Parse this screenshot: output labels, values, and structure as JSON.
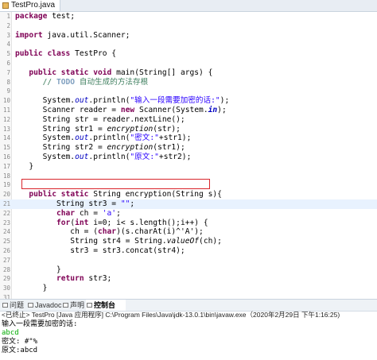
{
  "editor_tab": {
    "label": "TestPro.java"
  },
  "code_lines": [
    {
      "n": "1",
      "html": "<span class=\"kw\">package</span> test;"
    },
    {
      "n": "2",
      "html": ""
    },
    {
      "n": "3",
      "html": "<span class=\"kw\">import</span> java.util.Scanner;"
    },
    {
      "n": "4",
      "html": ""
    },
    {
      "n": "5",
      "html": "<span class=\"kw\">public</span> <span class=\"kw\">class</span> TestPro {"
    },
    {
      "n": "6",
      "html": ""
    },
    {
      "n": "7",
      "html": "   <span class=\"kw\">public</span> <span class=\"kw\">static</span> <span class=\"kw\">void</span> main(String[] args) {"
    },
    {
      "n": "8",
      "html": "      <span class=\"cmt\">// </span><span class=\"todo\">TODO</span><span class=\"cmt\"> 自动生成的方法存根</span>"
    },
    {
      "n": "9",
      "html": ""
    },
    {
      "n": "10",
      "html": "      System.<span class=\"fld\">out</span>.println(<span class=\"str\">\"输入一段需要加密的话:\"</span>);"
    },
    {
      "n": "11",
      "html": "      Scanner reader = <span class=\"kw\">new</span> Scanner(System.<span class=\"fldb\">in</span>);"
    },
    {
      "n": "12",
      "html": "      String str = reader.nextLine();"
    },
    {
      "n": "13",
      "html": "      String str1 = <span class=\"ital\">encryption</span>(str);"
    },
    {
      "n": "14",
      "html": "      System.<span class=\"fld\">out</span>.println(<span class=\"str\">\"密文:\"</span>+str1);"
    },
    {
      "n": "15",
      "html": "      String str2 = <span class=\"ital\">encryption</span>(str1);"
    },
    {
      "n": "16",
      "html": "      System.<span class=\"fld\">out</span>.println(<span class=\"str\">\"原文:\"</span>+str2);"
    },
    {
      "n": "17",
      "html": "   }"
    },
    {
      "n": "18",
      "html": ""
    },
    {
      "n": "19",
      "html": ""
    },
    {
      "n": "20",
      "html": "   <span class=\"kw\">public</span> <span class=\"kw\">static</span> String encryption(String s){"
    },
    {
      "n": "21",
      "html": "         String str3 = <span class=\"str\">\"\"</span>;"
    },
    {
      "n": "22",
      "html": "         <span class=\"kw\">char</span> ch = <span class=\"str\">'a'</span>;"
    },
    {
      "n": "23",
      "html": "         <span class=\"kw\">for</span>(<span class=\"kw\">int</span> i=0; i< s.length();i++) {"
    },
    {
      "n": "24",
      "html": "            ch = (<span class=\"kw\">char</span>)(s.charAt(i)^'A');"
    },
    {
      "n": "25",
      "html": "            String str4 = String.<span class=\"ital\">valueOf</span>(ch);"
    },
    {
      "n": "26",
      "html": "            str3 = str3.concat(str4);"
    },
    {
      "n": "27",
      "html": ""
    },
    {
      "n": "28",
      "html": "         }"
    },
    {
      "n": "29",
      "html": "         <span class=\"kw\">return</span> str3;"
    },
    {
      "n": "30",
      "html": "      }"
    },
    {
      "n": "31",
      "html": ""
    },
    {
      "n": "32",
      "html": "}"
    },
    {
      "n": "33",
      "html": ""
    }
  ],
  "console": {
    "tabs": [
      "问题",
      "Javadoc",
      "声明",
      "控制台"
    ],
    "title": "<已终止> TestPro [Java 应用程序] C:\\Program Files\\Java\\jdk-13.0.1\\bin\\javaw.exe（2020年2月29日 下午1:16:25)",
    "lines": [
      {
        "text": "输入一段需要加密的话:",
        "kind": "out"
      },
      {
        "text": "abcd",
        "kind": "in"
      },
      {
        "text": "密文: #\"%",
        "kind": "out"
      },
      {
        "text": "原文:abcd",
        "kind": "out"
      }
    ]
  }
}
